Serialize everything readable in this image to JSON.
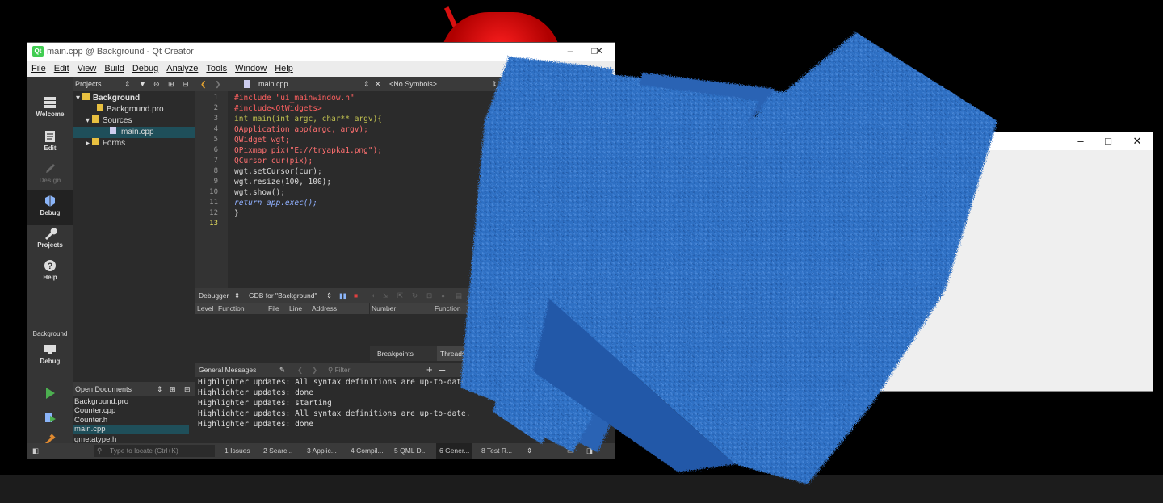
{
  "qt": {
    "title": "main.cpp @ Background - Qt Creator",
    "menu": [
      "File",
      "Edit",
      "View",
      "Build",
      "Debug",
      "Analyze",
      "Tools",
      "Window",
      "Help"
    ],
    "projects_label": "Projects",
    "file_tab": "main.cpp",
    "symbols": "<No Symbols>",
    "modes": [
      "Welcome",
      "Edit",
      "Design",
      "Debug",
      "Projects",
      "Help"
    ],
    "target_label": "Background",
    "target_mode": "Debug",
    "tree": [
      {
        "label": "Background",
        "level": 0
      },
      {
        "label": "Background.pro",
        "level": 1
      },
      {
        "label": "Sources",
        "level": 1
      },
      {
        "label": "main.cpp",
        "level": 2
      },
      {
        "label": "Forms",
        "level": 1
      }
    ],
    "code_lines": [
      "#include \"ui_mainwindow.h\"",
      "#include<QtWidgets>",
      "int main(int argc, char** argv){",
      "QApplication app(argc, argv);",
      "QWidget wgt;",
      "QPixmap pix(\"E://tryapka1.png\");",
      "QCursor cur(pix);",
      "wgt.setCursor(cur);",
      "wgt.resize(100, 100);",
      "wgt.show();",
      "return app.exec();",
      "}",
      ""
    ],
    "line_numbers": [
      "1",
      "2",
      "3",
      "4",
      "5",
      "6",
      "7",
      "8",
      "9",
      "10",
      "11",
      "12",
      "13"
    ],
    "debugger": {
      "label": "Debugger",
      "gdb": "GDB for \"Background\"",
      "cols_left": [
        "Level",
        "Function",
        "File",
        "Line",
        "Address"
      ],
      "cols_right": [
        "Number",
        "Function"
      ],
      "tabs": [
        "Breakpoints",
        "Threads"
      ]
    },
    "messages": {
      "title": "General Messages",
      "filter_placeholder": "Filter",
      "lines": [
        "Highlighter updates: All syntax definitions are up-to-date.",
        "Highlighter updates: done",
        "Highlighter updates: starting",
        "Highlighter updates: All syntax definitions are up-to-date.",
        "Highlighter updates: done"
      ]
    },
    "open_docs": {
      "title": "Open Documents",
      "items": [
        "Background.pro",
        "Counter.cpp",
        "Counter.h",
        "main.cpp",
        "qmetatype.h"
      ]
    },
    "locate_placeholder": "Type to locate (Ctrl+K)",
    "status_tabs": [
      "1 Issues",
      "2 Searc...",
      "3 Applic...",
      "4 Compil...",
      "5 QML D...",
      "6 Gener...",
      "8 Test R..."
    ]
  },
  "window2": {
    "controls": [
      "–",
      "□",
      "✕"
    ]
  },
  "qt_controls": [
    "–",
    "□",
    "✕"
  ],
  "colors": {
    "accent": "#1f4f5a",
    "towel": "#2f6fc4",
    "red": "#d81010"
  }
}
